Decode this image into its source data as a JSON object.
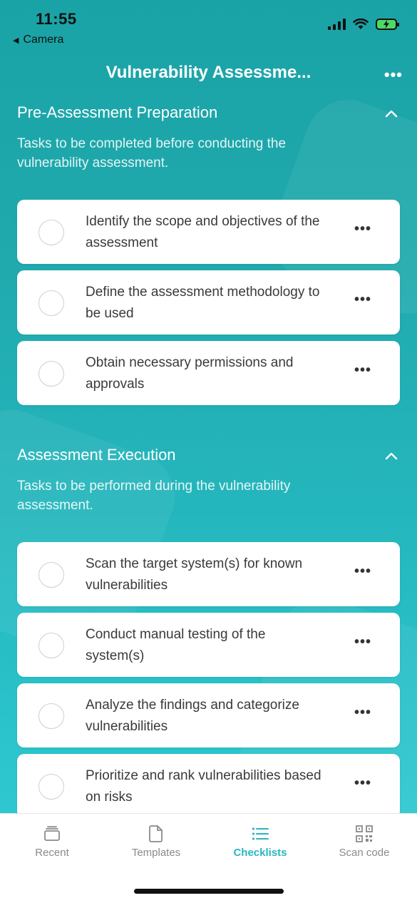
{
  "status": {
    "time": "11:55",
    "back_app": "Camera"
  },
  "nav": {
    "title": "Vulnerability Assessme...",
    "more": "•••"
  },
  "sections": [
    {
      "title": "Pre-Assessment Preparation",
      "description": "Tasks to be completed before conducting the vulnerability assessment.",
      "items": [
        {
          "label": "Identify the scope and objectives of the assessment"
        },
        {
          "label": "Define the assessment methodology to be used"
        },
        {
          "label": "Obtain necessary permissions and approvals"
        }
      ]
    },
    {
      "title": "Assessment Execution",
      "description": "Tasks to be performed during the vulnerability assessment.",
      "items": [
        {
          "label": "Scan the target system(s) for known vulnerabilities"
        },
        {
          "label": "Conduct manual testing of the system(s)"
        },
        {
          "label": "Analyze the findings and categorize vulnerabilities"
        },
        {
          "label": "Prioritize and rank vulnerabilities based on risks"
        }
      ]
    }
  ],
  "item_more": "•••",
  "tabs": [
    {
      "label": "Recent",
      "icon": "tray-stack-icon",
      "active": false
    },
    {
      "label": "Templates",
      "icon": "document-icon",
      "active": false
    },
    {
      "label": "Checklists",
      "icon": "list-icon",
      "active": true
    },
    {
      "label": "Scan code",
      "icon": "qr-code-icon",
      "active": false
    }
  ],
  "colors": {
    "accent": "#28b6c1",
    "background": "#1aa3a6"
  }
}
